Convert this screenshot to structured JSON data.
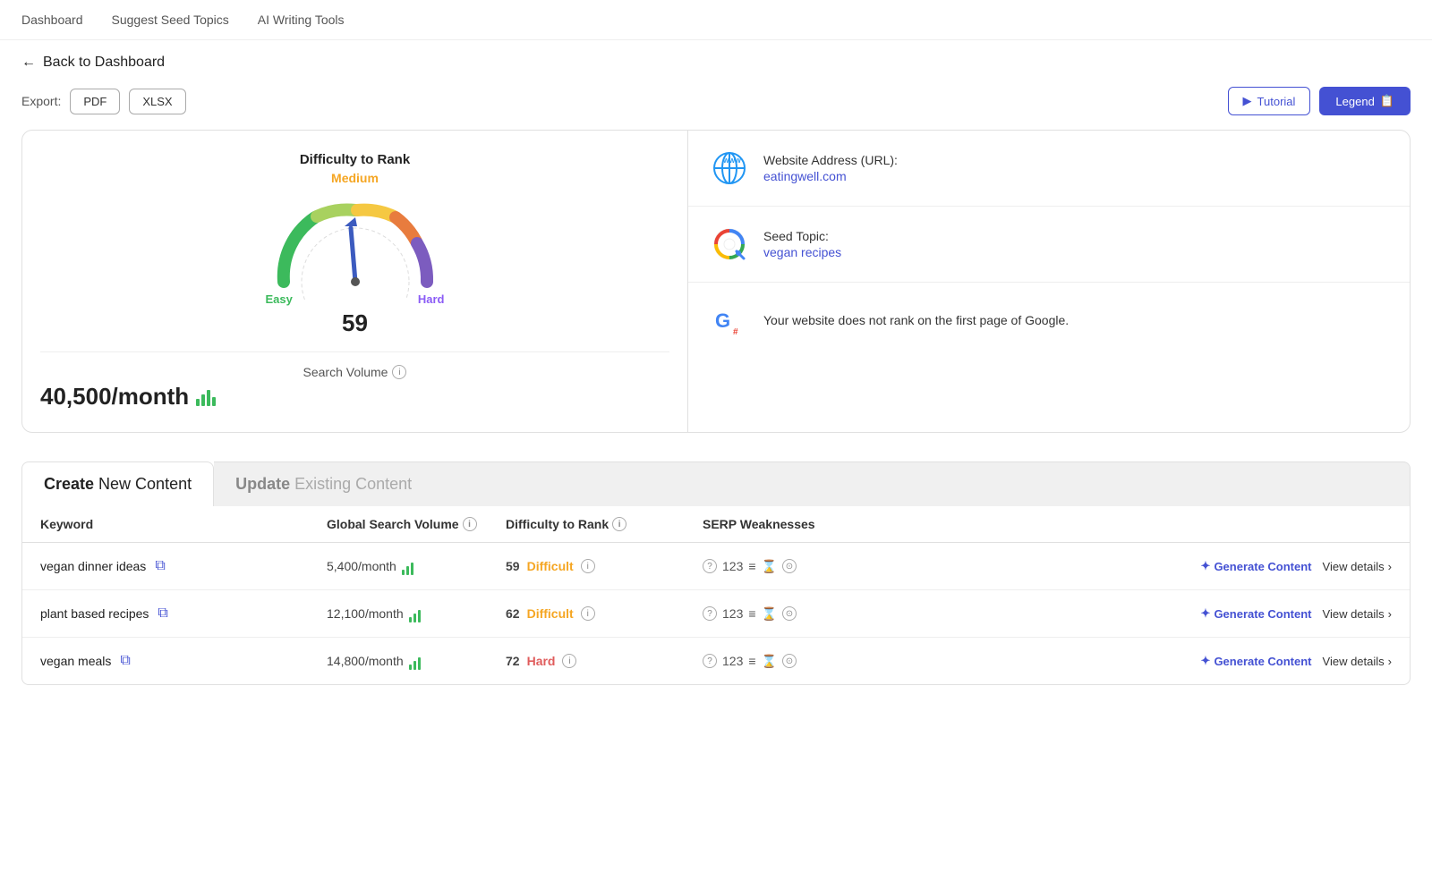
{
  "nav": {
    "items": [
      {
        "label": "Dashboard",
        "id": "dashboard"
      },
      {
        "label": "Suggest Seed Topics",
        "id": "suggest"
      },
      {
        "label": "AI Writing Tools",
        "id": "ai-writing"
      }
    ]
  },
  "back_label": "Back to Dashboard",
  "toolbar": {
    "export_label": "Export:",
    "pdf_label": "PDF",
    "xlsx_label": "XLSX",
    "tutorial_label": "Tutorial",
    "legend_label": "Legend"
  },
  "gauge": {
    "title": "Difficulty to Rank",
    "level": "Medium",
    "value": "59",
    "easy_label": "Easy",
    "hard_label": "Hard"
  },
  "search_volume": {
    "label": "Search Volume",
    "value": "40,500/month"
  },
  "website": {
    "label": "Website Address (URL):",
    "url": "eatingwell.com"
  },
  "seed_topic": {
    "label": "Seed Topic:",
    "value": "vegan recipes"
  },
  "google_note": "Your website does not rank on the first page of Google.",
  "tabs": {
    "create_bold": "Create",
    "create_rest": " New Content",
    "update_bold": "Update",
    "update_rest": " Existing Content"
  },
  "table": {
    "headers": {
      "keyword": "Keyword",
      "volume": "Global Search Volume",
      "difficulty": "Difficulty to Rank",
      "serp": "SERP Weaknesses"
    },
    "rows": [
      {
        "keyword": "vegan dinner ideas",
        "volume": "5,400/month",
        "diff_number": "59",
        "diff_label": "Difficult",
        "diff_type": "difficult",
        "serp": "? 123",
        "generate": "Generate Content",
        "view": "View details"
      },
      {
        "keyword": "plant based recipes",
        "volume": "12,100/month",
        "diff_number": "62",
        "diff_label": "Difficult",
        "diff_type": "difficult",
        "serp": "? 123",
        "generate": "Generate Content",
        "view": "View details"
      },
      {
        "keyword": "vegan meals",
        "volume": "14,800/month",
        "diff_number": "72",
        "diff_label": "Hard",
        "diff_type": "hard",
        "serp": "? 123",
        "generate": "Generate Content",
        "view": "View details"
      }
    ]
  }
}
